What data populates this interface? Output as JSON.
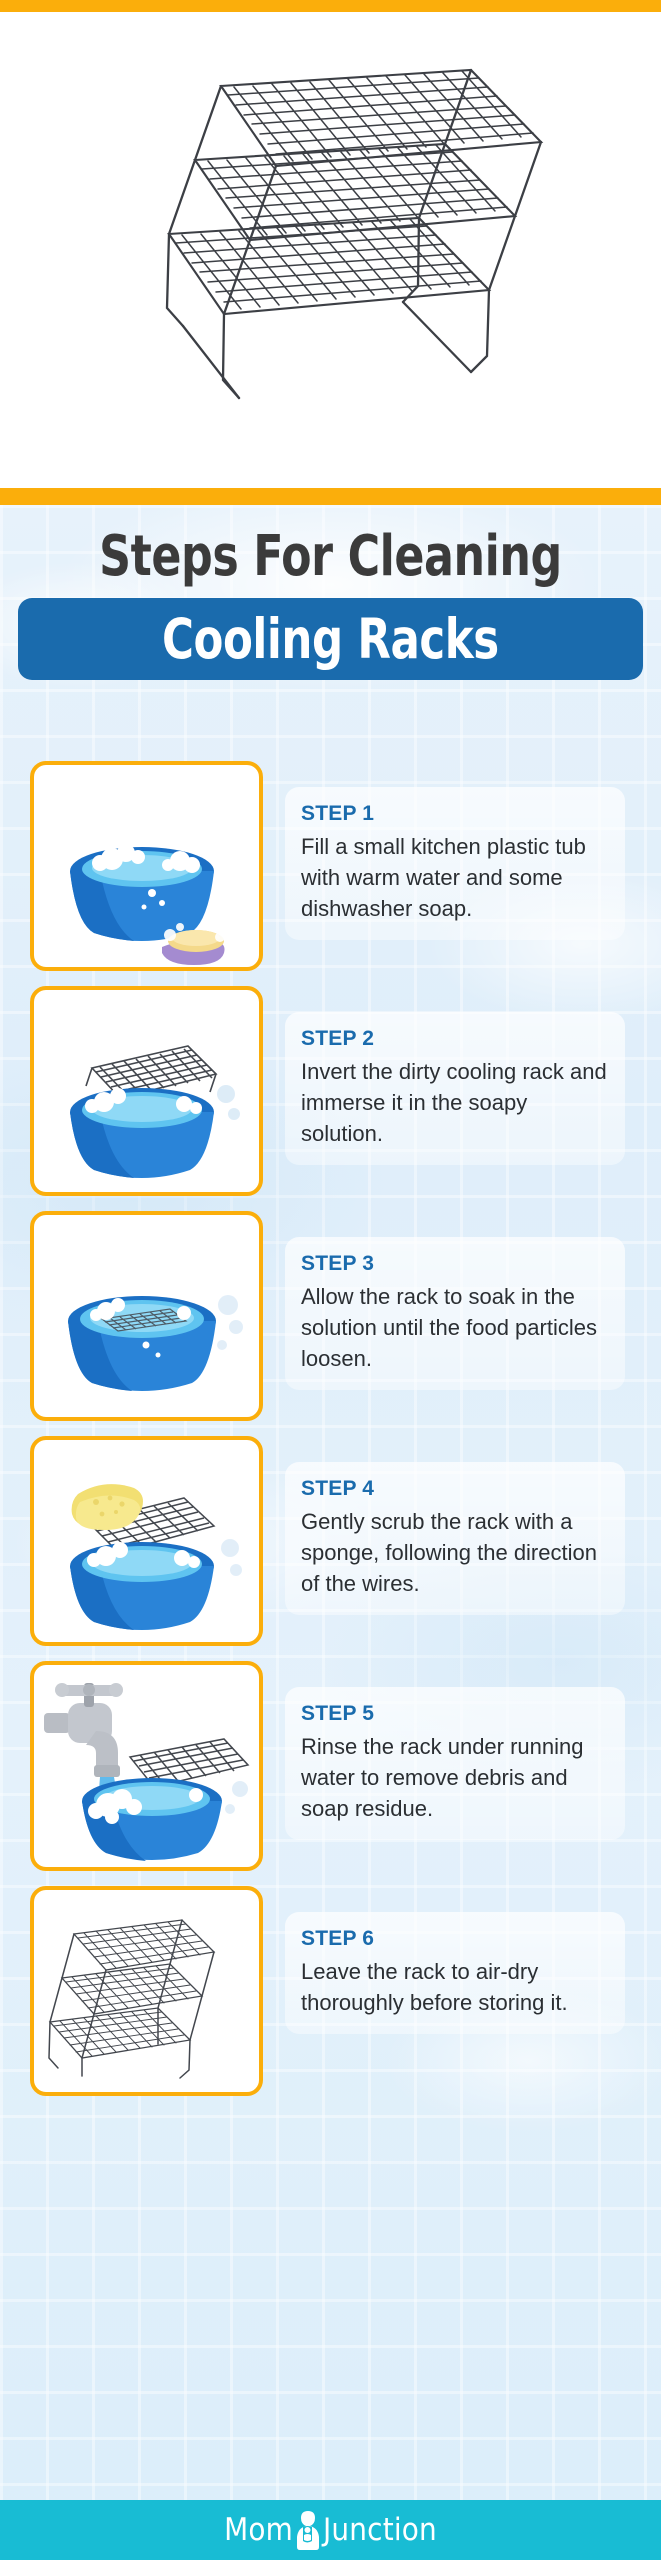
{
  "colors": {
    "orange": "#FBAE0B",
    "blue": "#1A6BAD",
    "step_label_blue": "#1A6BAD",
    "body_text": "#2B2F33",
    "title_dark": "#3B3B3B",
    "footer_teal": "#18BCD4",
    "card_border": "#FBAE0B",
    "background_light_blue": "#E2EFFA"
  },
  "hero": {
    "alt": "three-tier black wire cooling rack",
    "icon": "cooling-rack-illustration"
  },
  "title": {
    "line1": "Steps For Cleaning",
    "line2": "Cooling Racks"
  },
  "steps": [
    {
      "label": "STEP 1",
      "text": "Fill a small kitchen plastic tub with warm water and some dishwasher soap.",
      "illustration": "tub-with-soapy-water-and-soap-bar"
    },
    {
      "label": "STEP 2",
      "text": "Invert the dirty cooling rack and immerse it in the soapy solution.",
      "illustration": "rack-inverted-into-tub"
    },
    {
      "label": "STEP 3",
      "text": "Allow the rack to soak in the solution until the food particles loosen.",
      "illustration": "rack-soaking-in-tub"
    },
    {
      "label": "STEP 4",
      "text": "Gently scrub the rack with a sponge, following the direction of the wires.",
      "illustration": "sponge-scrubbing-rack"
    },
    {
      "label": "STEP 5",
      "text": "Rinse the rack under running water to remove debris and soap residue.",
      "illustration": "faucet-rinsing-rack"
    },
    {
      "label": "STEP 6",
      "text": "Leave the rack to air-dry thoroughly before storing it.",
      "illustration": "cooling-rack-air-drying"
    }
  ],
  "footer": {
    "logo_text_left": "Mom",
    "logo_text_right": "Junction",
    "logo_mark": "mom-and-baby-icon"
  }
}
